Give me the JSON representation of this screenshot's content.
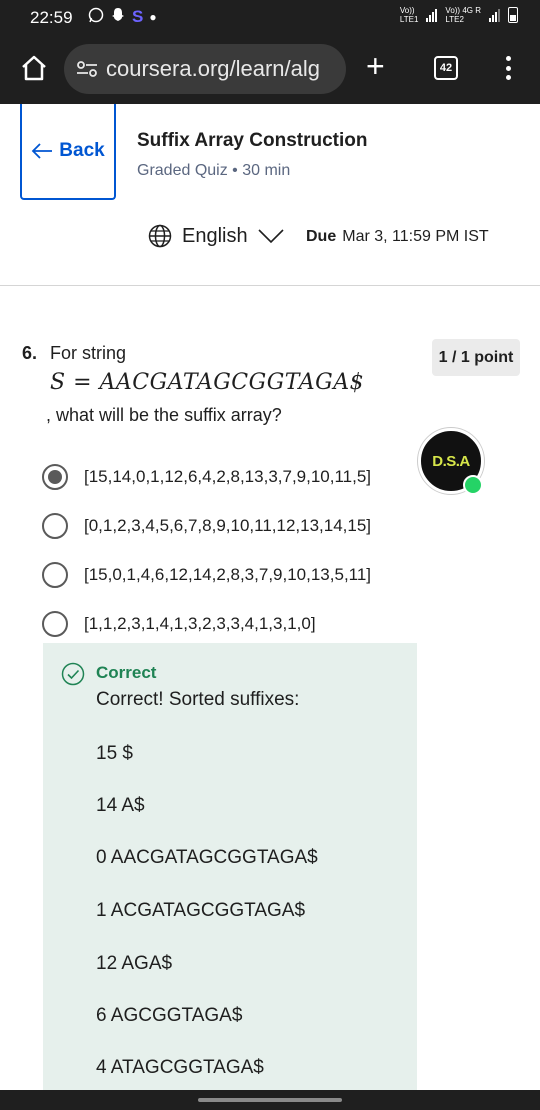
{
  "status_bar": {
    "time": "22:59",
    "carrier1_top": "Vo))",
    "carrier1_bottom": "LTE1",
    "carrier2_top": "Vo)) 4G R",
    "carrier2_bottom": "LTE2"
  },
  "browser": {
    "url": "coursera.org/learn/alg",
    "plus": "+",
    "tab_count": "42"
  },
  "header": {
    "back_label": "Back",
    "title": "Suffix Array Construction",
    "meta": "Graded Quiz • 30 min",
    "language": "English",
    "due_label": "Due",
    "due_value": "Mar 3, 11:59 PM IST"
  },
  "question": {
    "number": "6.",
    "text_before": "For string",
    "math": "S = AACGATAGCGGTAGA$",
    "text_after": ", what will be the suffix array?",
    "points": "1 / 1 point",
    "options": [
      {
        "label": "[15,14,0,1,12,6,4,2,8,13,3,7,9,10,11,5]",
        "selected": true
      },
      {
        "label": "[0,1,2,3,4,5,6,7,8,9,10,11,12,13,14,15]",
        "selected": false
      },
      {
        "label": "[15,0,1,4,6,12,14,2,8,3,7,9,10,13,5,11]",
        "selected": false
      },
      {
        "label": "[1,1,2,3,1,4,1,3,2,3,3,4,1,3,1,0]",
        "selected": false
      }
    ]
  },
  "badge": {
    "text": "D.S.A"
  },
  "feedback": {
    "status": "Correct",
    "message": "Correct! Sorted suffixes:",
    "suffixes": [
      "15 $",
      "14 A$",
      "0 AACGATAGCGGTAGA$",
      "1 ACGATAGCGGTAGA$",
      "12 AGA$",
      "6 AGCGGTAGA$",
      "4 ATAGCGGTAGA$"
    ]
  }
}
